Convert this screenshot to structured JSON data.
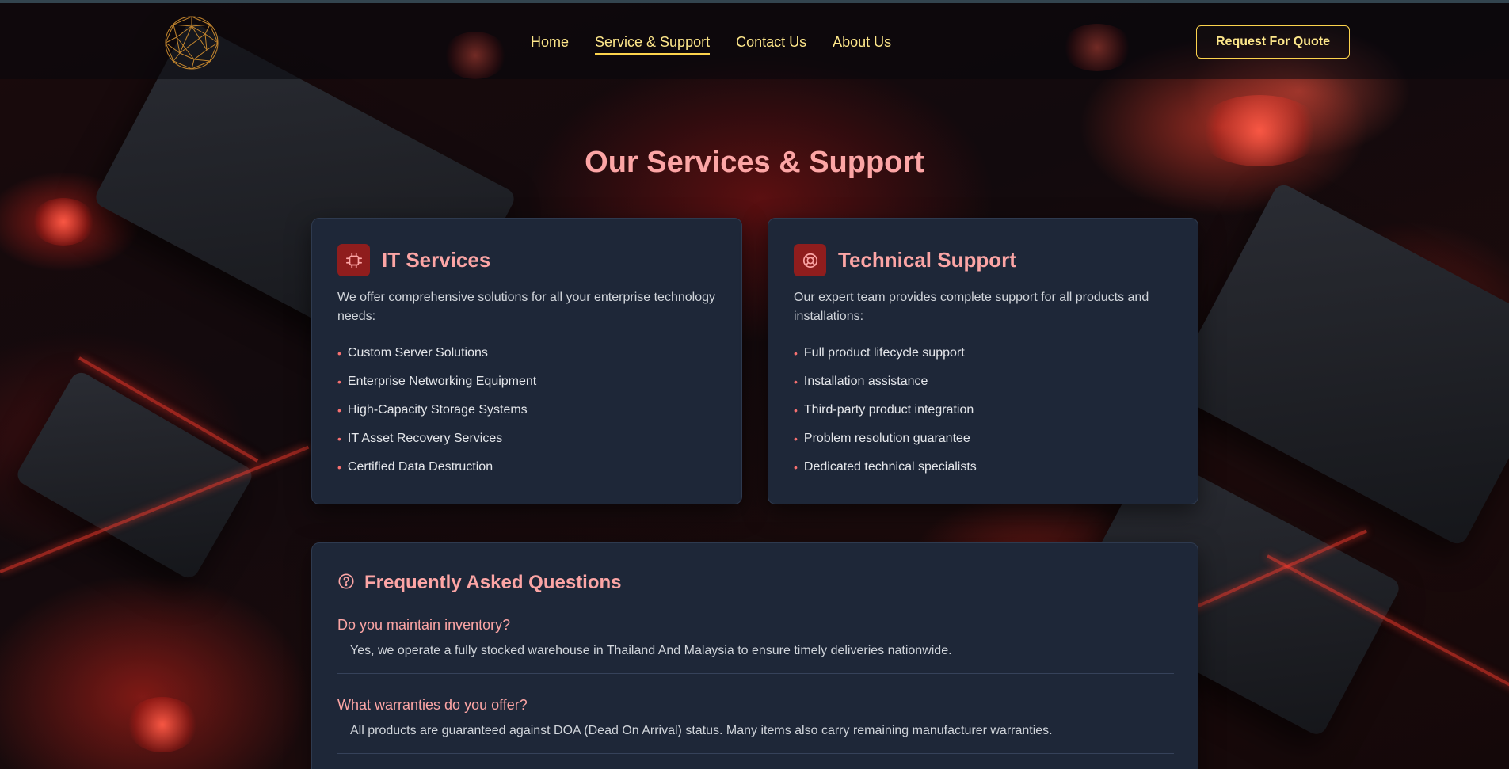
{
  "header": {
    "logo": "globe-wireframe-logo",
    "nav": [
      {
        "label": "Home",
        "active": false
      },
      {
        "label": "Service & Support",
        "active": true
      },
      {
        "label": "Contact Us",
        "active": false
      },
      {
        "label": "About Us",
        "active": false
      }
    ],
    "cta_label": "Request For Quote"
  },
  "main": {
    "title": "Our Services & Support",
    "cards": [
      {
        "icon": "cpu-chip-icon",
        "title": "IT Services",
        "description": "We offer comprehensive solutions for all your enterprise technology needs:",
        "items": [
          "Custom Server Solutions",
          "Enterprise Networking Equipment",
          "High-Capacity Storage Systems",
          "IT Asset Recovery Services",
          "Certified Data Destruction"
        ]
      },
      {
        "icon": "lifebuoy-icon",
        "title": "Technical Support",
        "description": "Our expert team provides complete support for all products and installations:",
        "items": [
          "Full product lifecycle support",
          "Installation assistance",
          "Third-party product integration",
          "Problem resolution guarantee",
          "Dedicated technical specialists"
        ]
      }
    ],
    "faq": {
      "icon": "question-circle-icon",
      "title": "Frequently Asked Questions",
      "items": [
        {
          "question": "Do you maintain inventory?",
          "answer": "Yes, we operate a fully stocked warehouse in Thailand And Malaysia to ensure timely deliveries nationwide."
        },
        {
          "question": "What warranties do you offer?",
          "answer": "All products are guaranteed against DOA (Dead On Arrival) status. Many items also carry remaining manufacturer warranties."
        }
      ]
    }
  },
  "colors": {
    "accent_gold": "#fde68a",
    "heading_pink": "#fca5a5",
    "card_bg": "#1e2738",
    "icon_bg": "#8f1d1d",
    "bullet_red": "#f87171"
  }
}
